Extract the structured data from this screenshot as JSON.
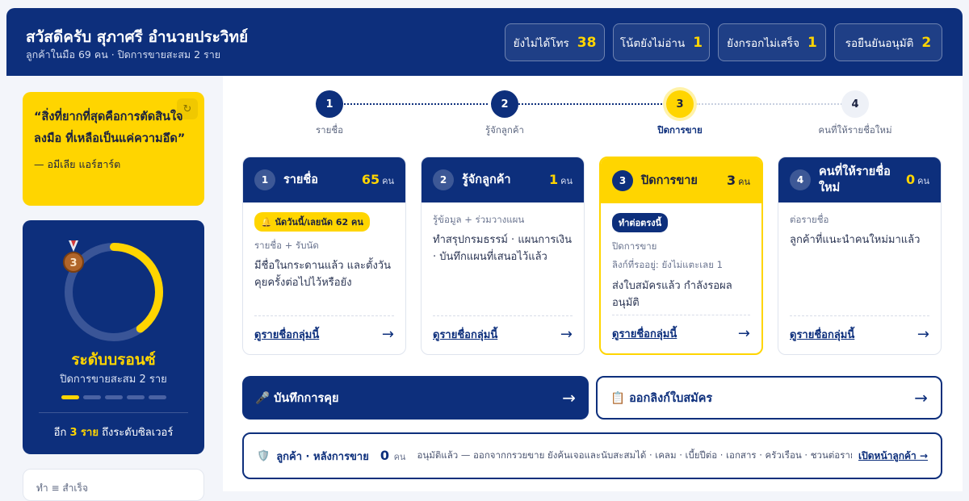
{
  "header": {
    "title": "สวัสดีครับ สุภาศรี อำนวยประวิทย์",
    "subtitle": "ลูกค้าในมือ 69 คน · ปิดการขายสะสม 2 ราย",
    "stats": [
      {
        "label": "ยังไม่ได้โทร",
        "value": "38"
      },
      {
        "label": "โน้ตยังไม่อ่าน",
        "value": "1"
      },
      {
        "label": "ยังกรอกไม่เสร็จ",
        "value": "1"
      },
      {
        "label": "รอยืนยันอนุมัติ",
        "value": "2"
      }
    ]
  },
  "quote": {
    "text": "“สิ่งที่ยากที่สุดคือการตัดสินใจลงมือ ที่เหลือเป็นแค่ความอึด”",
    "author": "— อมีเลีย แอร์ฮาร์ต"
  },
  "level": {
    "name": "ระดับบรอนซ์",
    "subtitle": "ปิดการขายสะสม 2 ราย",
    "progress": 0.4,
    "medal_rank": "3",
    "next_prefix": "อีก ",
    "next_count": "3 ราย",
    "next_suffix": " ถึงระดับซิลเวอร์"
  },
  "bottom_card": {
    "text": "ทำ ≡ สำเร็จ"
  },
  "steps": [
    {
      "num": "1",
      "label": "รายชื่อ"
    },
    {
      "num": "2",
      "label": "รู้จักลูกค้า"
    },
    {
      "num": "3",
      "label": "ปิดการขาย"
    },
    {
      "num": "4",
      "label": "คนที่ให้รายชื่อใหม่"
    }
  ],
  "cards": [
    {
      "num": "1",
      "name": "รายชื่อ",
      "count": "65",
      "unit": "คน",
      "badge": "🔔 นัดวันนี้/เลยนัด 62 คน",
      "meta": "รายชื่อ + รับนัด",
      "meta2": "",
      "desc": "มีชื่อในกระดานแล้ว และตั้งวันคุยครั้งต่อไปไว้หรือยัง",
      "link": "ดูรายชื่อกลุ่มนี้"
    },
    {
      "num": "2",
      "name": "รู้จักลูกค้า",
      "count": "1",
      "unit": "คน",
      "badge": "",
      "meta": "รู้ข้อมูล + ร่วมวางแผน",
      "meta2": "",
      "desc": "ทำสรุปกรมธรรม์ · แผนการเงิน · บันทึกแผนที่เสนอไว้แล้ว",
      "link": "ดูรายชื่อกลุ่มนี้"
    },
    {
      "num": "3",
      "name": "ปิดการขาย",
      "count": "3",
      "unit": "คน",
      "badge": "ทำต่อตรงนี้",
      "meta": "ปิดการขาย",
      "meta2": "ลิงก์ที่รออยู่: ยังไม่แตะเลย 1",
      "desc": "ส่งใบสมัครแล้ว กำลังรอผลอนุมัติ",
      "link": "ดูรายชื่อกลุ่มนี้"
    },
    {
      "num": "4",
      "name": "คนที่ให้รายชื่อใหม่",
      "count": "0",
      "unit": "คน",
      "badge": "",
      "meta": "ต่อรายชื่อ",
      "meta2": "",
      "desc": "ลูกค้าที่แนะนำคนใหม่มาแล้ว",
      "link": "ดูรายชื่อกลุ่มนี้"
    }
  ],
  "actions": {
    "record": "🎤 บันทึกการคุย",
    "issue": "📋 ออกลิงก์ใบสมัคร",
    "arrow": "→"
  },
  "after_sales": {
    "icon": "🛡️",
    "title": "ลูกค้า · หลังการขาย",
    "count": "0",
    "unit": "คน",
    "desc": "อนุมัติแล้ว — ออกจากกรวยขาย ยังค้นเจอและนับสะสมได้ · เคลม · เบี้ยปีต่อ · เอกสาร · ครัวเรือน · ชวนต่อรายชื่อ",
    "link": "เปิดหน้าลูกค้า →"
  },
  "colors": {
    "navy": "#0d2f7c",
    "yellow": "#ffd500"
  }
}
